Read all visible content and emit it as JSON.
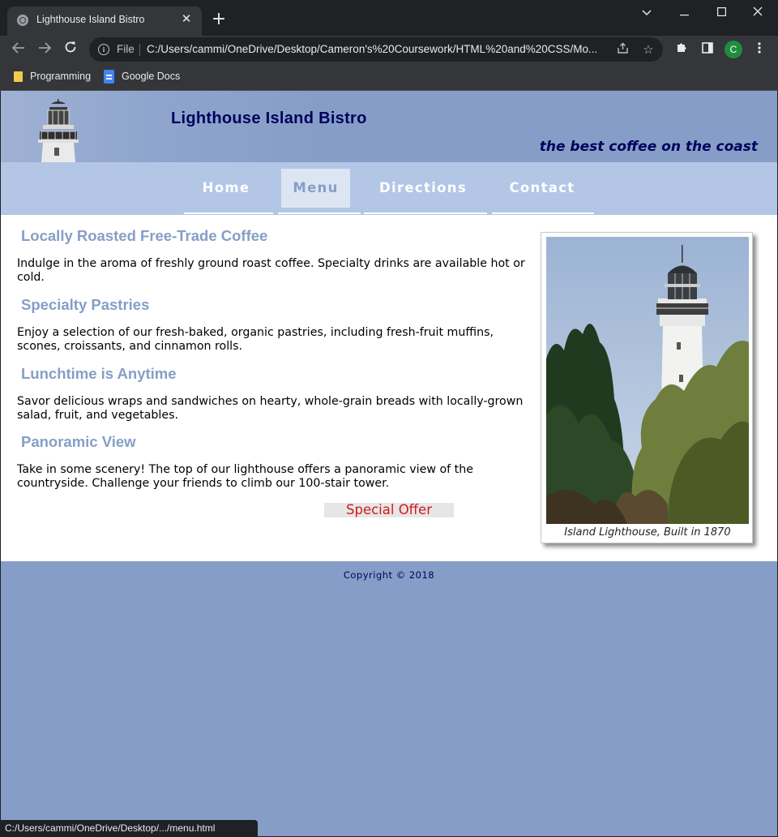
{
  "browser": {
    "tab_title": "Lighthouse Island Bistro",
    "url_scheme_label": "File",
    "url": "C:/Users/cammi/OneDrive/Desktop/Cameron's%20Coursework/HTML%20and%20CSS/Mo...",
    "profile_initial": "C",
    "bookmarks": [
      {
        "label": "Programming",
        "icon": "folder-icon"
      },
      {
        "label": "Google Docs",
        "icon": "google-docs-icon"
      }
    ],
    "status_text": "C:/Users/cammi/OneDrive/Desktop/.../menu.html"
  },
  "site": {
    "title": "Lighthouse Island Bistro",
    "tagline": "the best coffee on the coast",
    "nav": [
      {
        "label": "Home",
        "active": false
      },
      {
        "label": "Menu",
        "active": true
      },
      {
        "label": "Directions",
        "active": false
      },
      {
        "label": "Contact",
        "active": false
      }
    ],
    "sections": [
      {
        "heading": "Locally Roasted Free-Trade Coffee",
        "body": "Indulge in the aroma of freshly ground roast coffee. Specialty drinks are available hot or cold."
      },
      {
        "heading": "Specialty Pastries",
        "body": "Enjoy a selection of our fresh-baked, organic pastries, including fresh-fruit muffins, scones, croissants, and cinnamon rolls."
      },
      {
        "heading": "Lunchtime is Anytime",
        "body": "Savor delicious wraps and sandwiches on hearty, whole-grain breads with locally-grown salad, fruit, and vegetables."
      },
      {
        "heading": "Panoramic View",
        "body": "Take in some scenery! The top of our lighthouse offers a panoramic view of the countryside. Challenge your friends to climb our 100-stair tower."
      }
    ],
    "special_offer": "Special Offer",
    "figure_caption": "Island Lighthouse, Built in 1870",
    "copyright": "Copyright © 2018"
  },
  "colors": {
    "page_background": "#869ec7",
    "nav_background": "#b3c6e6",
    "heading": "#869ec7",
    "title_text": "#00005c",
    "special_offer_text": "#d11a1a"
  }
}
